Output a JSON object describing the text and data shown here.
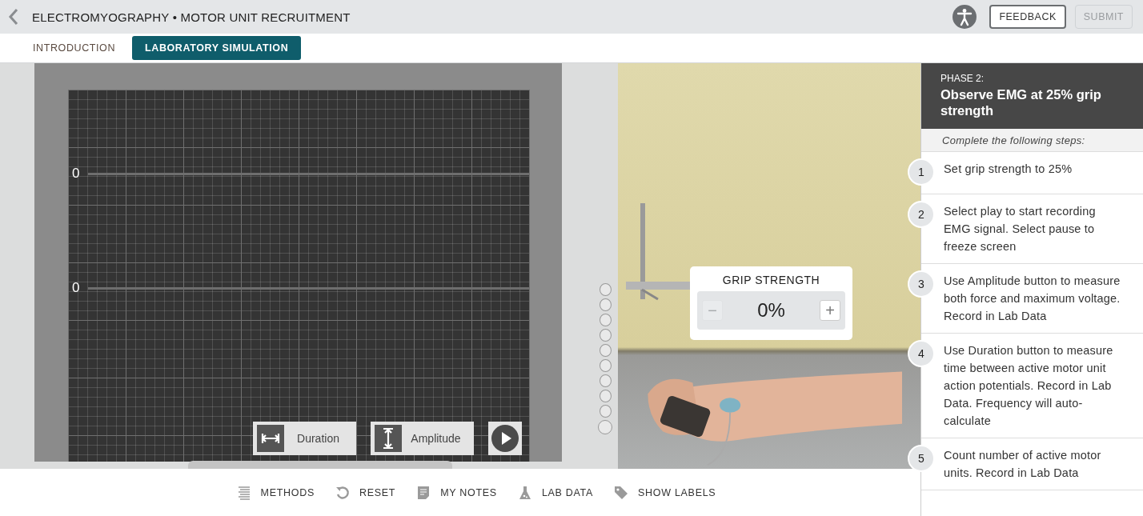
{
  "header": {
    "title": "ELECTROMYOGRAPHY • MOTOR UNIT RECRUITMENT",
    "feedback": "FEEDBACK",
    "submit": {
      "label": "SUBMIT",
      "disabled": true
    }
  },
  "tabs": [
    {
      "label": "INTRODUCTION",
      "selected": false
    },
    {
      "label": "LABORATORY SIMULATION",
      "selected": true
    }
  ],
  "oscilloscope": {
    "traces": [
      {
        "label": "0"
      },
      {
        "label": "0"
      }
    ],
    "buttons": [
      {
        "kind": "duration",
        "label": "Duration"
      },
      {
        "kind": "amplitude",
        "label": "Amplitude"
      },
      {
        "kind": "play"
      }
    ]
  },
  "grip": {
    "title": "GRIP STRENGTH",
    "value": "0%",
    "decrease": {
      "label": "−",
      "disabled": true
    },
    "increase": {
      "label": "+",
      "disabled": false
    }
  },
  "toolbar": [
    {
      "kind": "methods",
      "label": "METHODS"
    },
    {
      "kind": "reset",
      "label": "RESET"
    },
    {
      "kind": "notes",
      "label": "MY NOTES"
    },
    {
      "kind": "lab",
      "label": "LAB DATA"
    },
    {
      "kind": "labels",
      "label": "SHOW LABELS"
    }
  ],
  "phase": {
    "label": "PHASE 2:",
    "title": "Observe EMG at 25% grip strength",
    "instructions": "Complete the following steps:",
    "steps": [
      {
        "number": "1",
        "text": "Set grip strength to 25%"
      },
      {
        "number": "2",
        "text": "Select play to start recording EMG signal. Select pause to freeze screen"
      },
      {
        "number": "3",
        "text": "Use Amplitude button to measure both force and maximum voltage. Record in Lab Data"
      },
      {
        "number": "4",
        "text": "Use Duration button to measure time between active motor unit action potentials. Record in Lab Data. Frequency will auto-calculate"
      },
      {
        "number": "5",
        "text": "Count number of active motor units. Record in Lab Data"
      }
    ]
  }
}
